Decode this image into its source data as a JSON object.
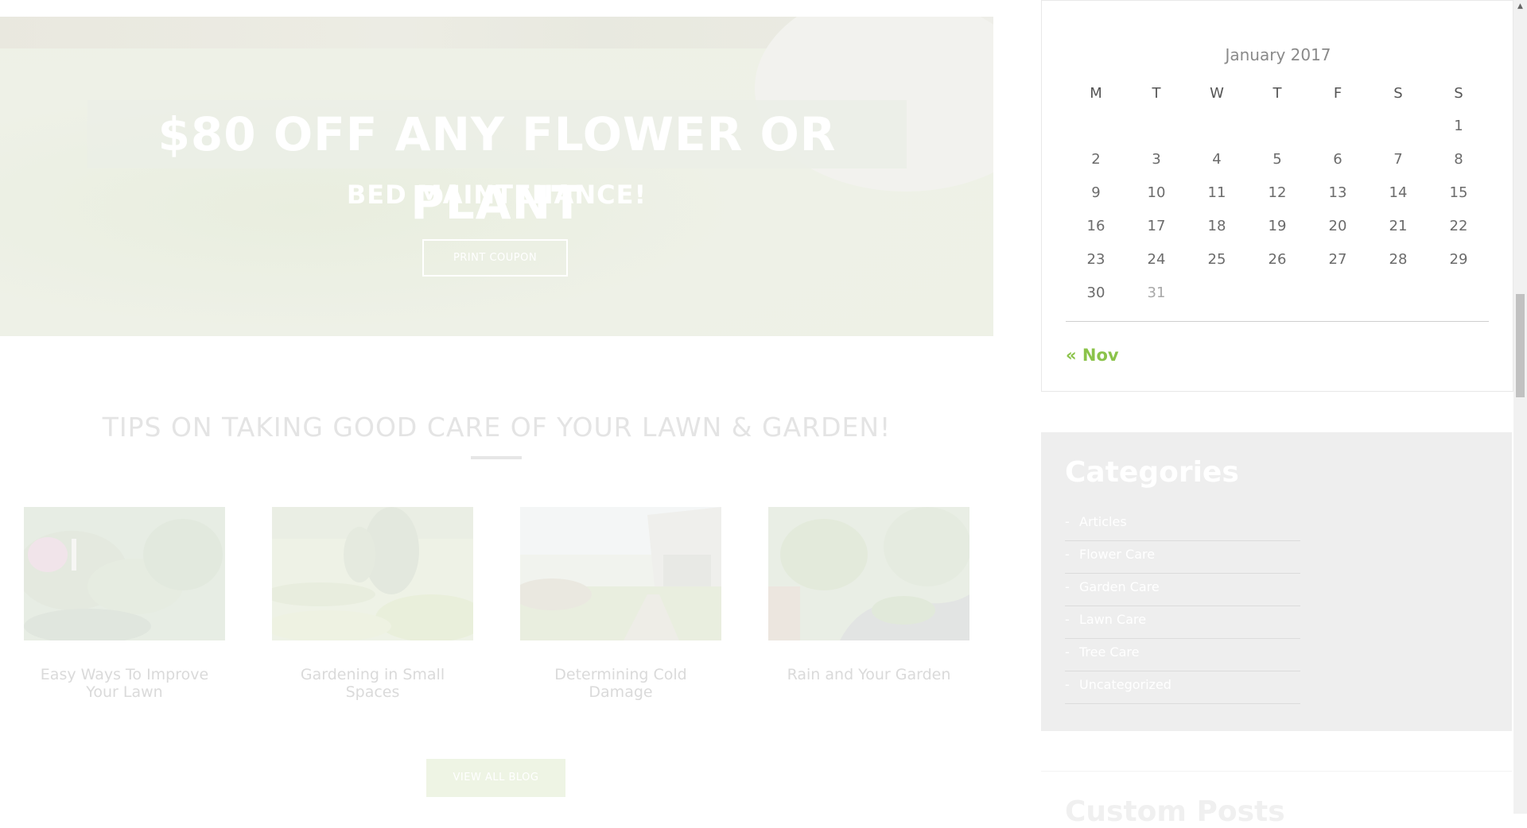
{
  "hero": {
    "title": "$80 OFF ANY FLOWER OR PLANT",
    "subtitle": "BED MAINTENANCE!",
    "button_label": "PRINT COUPON"
  },
  "tips": {
    "title": "TIPS ON TAKING GOOD CARE OF YOUR LAWN & GARDEN!",
    "posts": [
      {
        "title": "Easy Ways To Improve Your Lawn"
      },
      {
        "title": "Gardening in Small Spaces"
      },
      {
        "title": "Determining Cold Damage"
      },
      {
        "title": "Rain and Your Garden"
      }
    ],
    "view_all_label": "VIEW ALL BLOG"
  },
  "calendar": {
    "caption": "January 2017",
    "weekdays": [
      "M",
      "T",
      "W",
      "T",
      "F",
      "S",
      "S"
    ],
    "weeks": [
      [
        "",
        "",
        "",
        "",
        "",
        "",
        "1"
      ],
      [
        "2",
        "3",
        "4",
        "5",
        "6",
        "7",
        "8"
      ],
      [
        "9",
        "10",
        "11",
        "12",
        "13",
        "14",
        "15"
      ],
      [
        "16",
        "17",
        "18",
        "19",
        "20",
        "21",
        "22"
      ],
      [
        "23",
        "24",
        "25",
        "26",
        "27",
        "28",
        "29"
      ],
      [
        "30",
        "31",
        "",
        "",
        "",
        "",
        ""
      ]
    ],
    "prev_label": "« Nov"
  },
  "categories": {
    "title": "Categories",
    "items": [
      "Articles",
      "Flower Care",
      "Garden Care",
      "Lawn Care",
      "Tree Care",
      "Uncategorized"
    ]
  },
  "custom_posts": {
    "title": "Custom Posts"
  },
  "colors": {
    "accent": "#8bc34a"
  }
}
